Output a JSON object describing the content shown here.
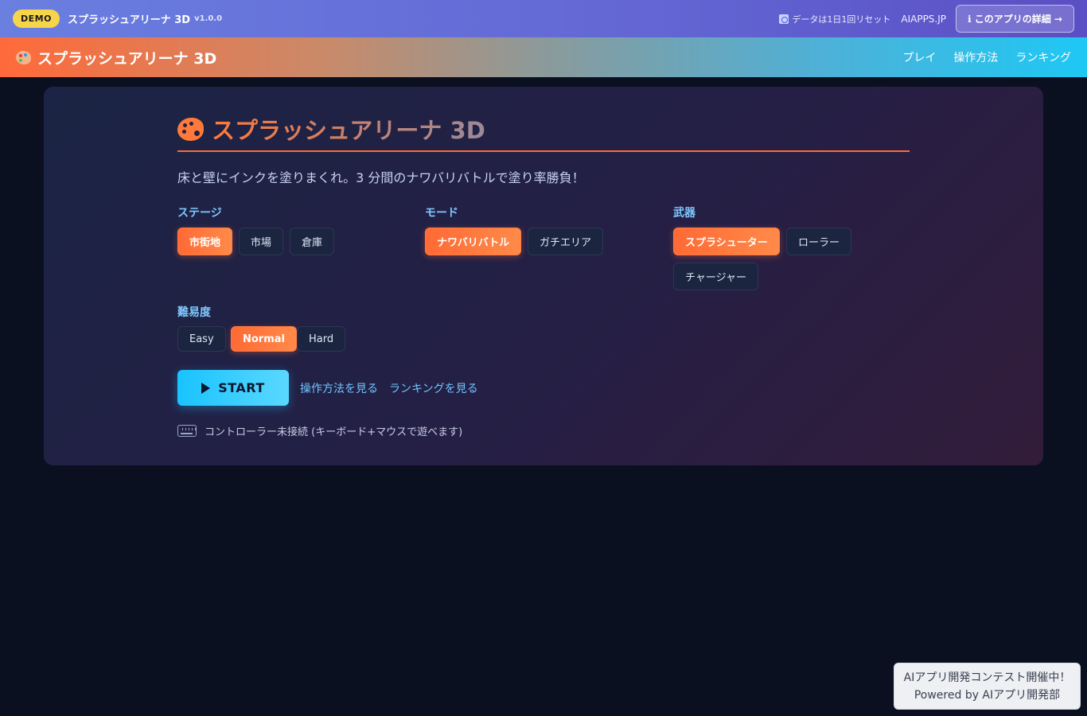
{
  "demo_bar": {
    "badge": "DEMO",
    "title": "スプラッシュアリーナ 3D",
    "version": "v1.0.0",
    "reset_note": "データは1日1回リセット",
    "site": "AIAPPS.JP",
    "detail_button": "ℹ このアプリの詳細 →"
  },
  "header": {
    "title": "スプラッシュアリーナ 3D",
    "nav": [
      "プレイ",
      "操作方法",
      "ランキング"
    ]
  },
  "main": {
    "title": "スプラッシュアリーナ 3D",
    "description": "床と壁にインクを塗りまくれ。3 分間のナワバリバトルで塗り率勝負！",
    "stage": {
      "label": "ステージ",
      "options": [
        "市街地",
        "市場",
        "倉庫"
      ],
      "selected": "市街地"
    },
    "mode": {
      "label": "モード",
      "options": [
        "ナワバリバトル",
        "ガチエリア"
      ],
      "selected": "ナワバリバトル"
    },
    "weapon": {
      "label": "武器",
      "options": [
        "スプラシューター",
        "ローラー",
        "チャージャー"
      ],
      "selected": "スプラシューター"
    },
    "difficulty": {
      "label": "難易度",
      "options": [
        "Easy",
        "Normal",
        "Hard"
      ],
      "selected": "Normal"
    },
    "start_button": "START",
    "controls_link": "操作方法を見る",
    "ranking_link": "ランキングを見る",
    "controller_status": "コントローラー未接続 (キーボード+マウスで遊べます)"
  },
  "contest": {
    "line1": "AIアプリ開発コンテスト開催中！",
    "line2": "Powered by AIアプリ開発部"
  },
  "colors": {
    "accent": "#ff6b35",
    "cyan": "#19c3ff",
    "background": "#0b1020"
  }
}
